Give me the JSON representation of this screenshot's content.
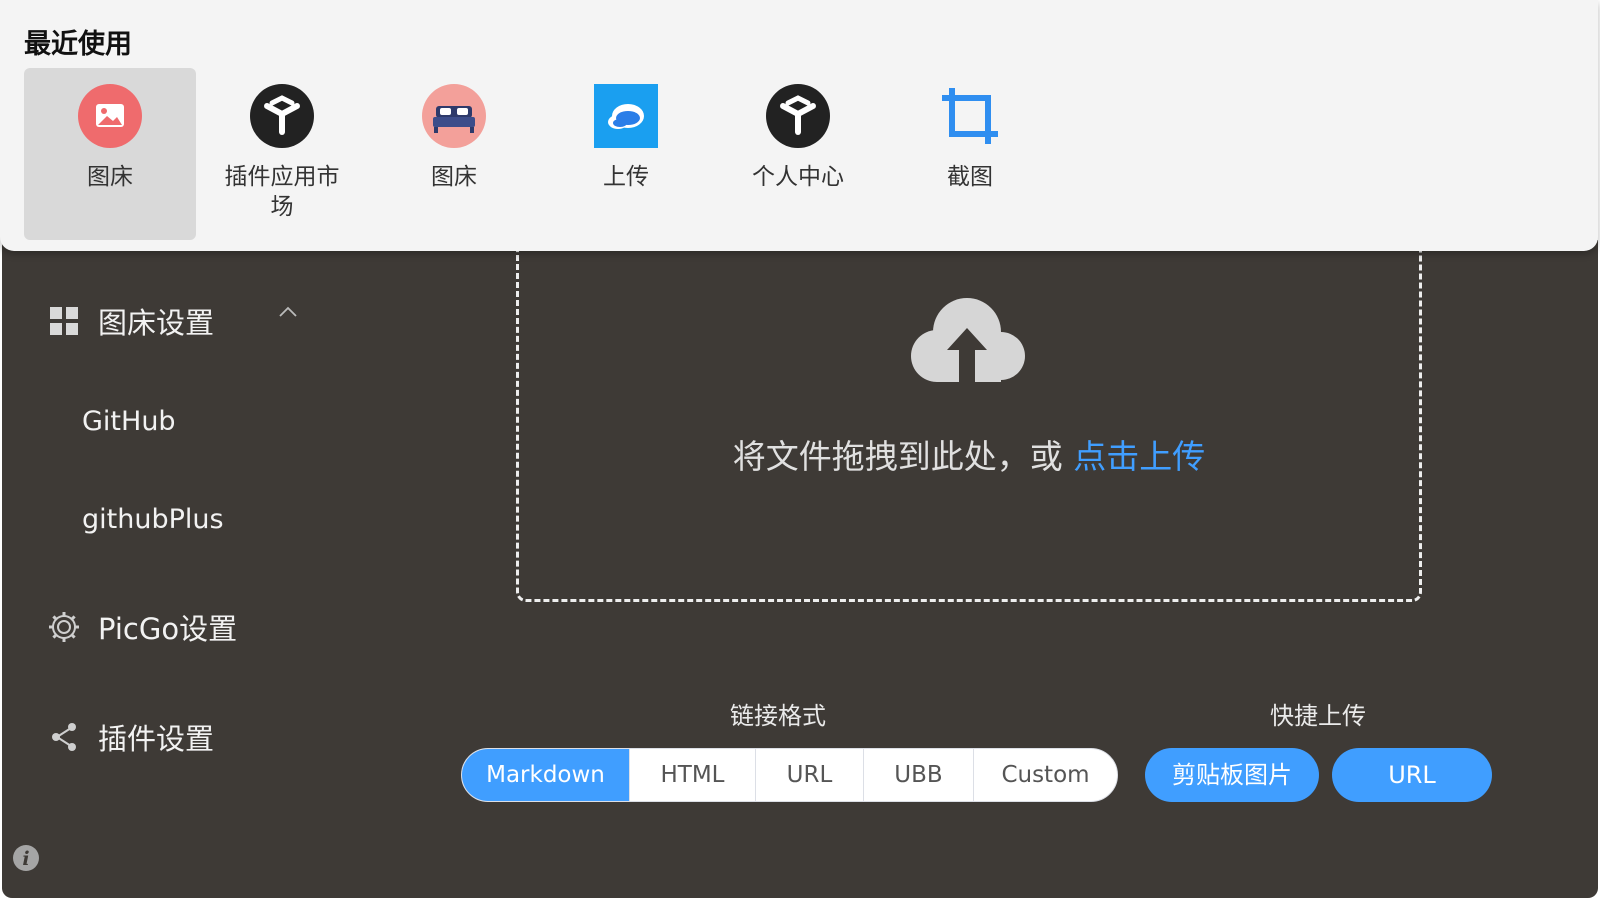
{
  "recent": {
    "title": "最近使用",
    "items": [
      {
        "label": "图床",
        "icon": "image-icon",
        "active": true
      },
      {
        "label": "插件应用市场",
        "icon": "plugin-market-icon"
      },
      {
        "label": "图床",
        "icon": "bed-icon"
      },
      {
        "label": "上传",
        "icon": "cloud-upload-app-icon"
      },
      {
        "label": "个人中心",
        "icon": "plugin-market-icon"
      },
      {
        "label": "截图",
        "icon": "crop-icon"
      }
    ]
  },
  "sidebar": {
    "picbed_settings": "图床设置",
    "sub_items": [
      "GitHub",
      "githubPlus"
    ],
    "picgo_settings": "PicGo设置",
    "plugin_settings": "插件设置"
  },
  "upload": {
    "drop_text": "将文件拖拽到此处，或",
    "drop_link": "点击上传"
  },
  "link_format": {
    "label": "链接格式",
    "options": [
      "Markdown",
      "HTML",
      "URL",
      "UBB",
      "Custom"
    ],
    "selected": "Markdown"
  },
  "quick_upload": {
    "label": "快捷上传",
    "clipboard": "剪贴板图片",
    "url": "URL"
  },
  "colors": {
    "accent": "#409eff",
    "background": "#3e3a36",
    "popover": "#f4f4f4"
  }
}
